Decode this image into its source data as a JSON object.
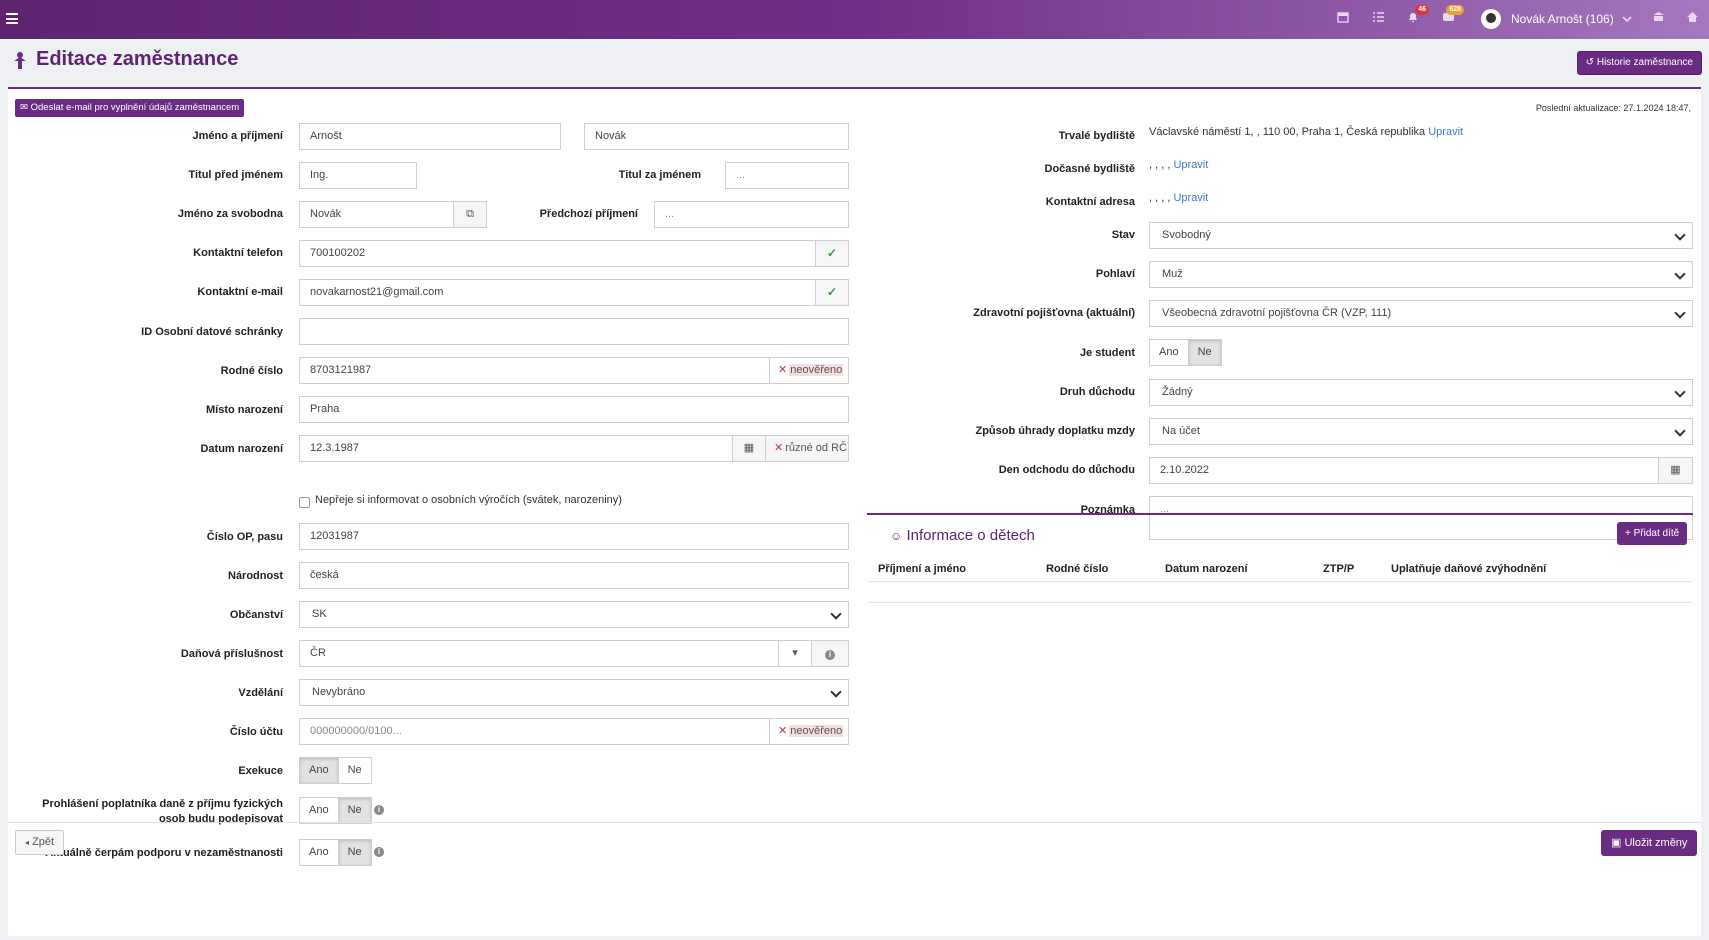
{
  "topbar": {
    "notifications_count": "46",
    "messages_count": "628",
    "user_name": "Novák Arnošt (106)"
  },
  "page": {
    "title": "Editace zaměstnance",
    "history_button": "Historie zaměstnance",
    "send_email_button": "Odeslat e-mail pro vyplnění údajů zaměstnancem",
    "last_update": "Poslední aktualizace: 27.1.2024 18:47,"
  },
  "left": {
    "name_label": "Jméno a příjmení",
    "first_name": "Arnošt",
    "last_name": "Novák",
    "title_before_label": "Titul před jménem",
    "title_before": "Ing.",
    "title_after_label": "Titul za jménem",
    "title_after_placeholder": "...",
    "maiden_label": "Jméno za svobodna",
    "maiden": "Novák",
    "prev_surname_label": "Předchozí příjmení",
    "prev_surname_placeholder": "...",
    "phone_label": "Kontaktní telefon",
    "phone": "700100202",
    "email_label": "Kontaktní e-mail",
    "email": "novakarnost21@gmail.com",
    "databox_label": "ID Osobní datové schránky",
    "databox": "",
    "birth_no_label": "Rodné číslo",
    "birth_no": "8703121987",
    "unverified": "neověřeno",
    "birth_place_label": "Místo narození",
    "birth_place": "Praha",
    "birth_date_label": "Datum narození",
    "birth_date": "12.3.1987",
    "differs_rc": "různé od RČ",
    "anniversary_checkbox": "Nepřeje si informovat o osobních výročích (svátek, narozeniny)",
    "id_card_label": "Číslo OP, pasu",
    "id_card": "12031987",
    "nationality_label": "Národnost",
    "nationality": "česká",
    "citizenship_label": "Občanství",
    "citizenship": "SK",
    "tax_residence_label": "Daňová příslušnost",
    "tax_residence": "ČR",
    "education_label": "Vzdělání",
    "education": "Nevybráno",
    "account_label": "Číslo účtu",
    "account_placeholder": "000000000/0100...",
    "execution_label": "Exekuce",
    "declaration_label": "Prohlášení poplatníka daně z příjmu fyzických osob budu podepisovat",
    "unemployment_label": "Aktuálně čerpám podporu v nezaměstnanosti",
    "yes": "Ano",
    "no": "Ne"
  },
  "right": {
    "perm_addr_label": "Trvalé bydliště",
    "perm_addr": "Václavské náměstí 1, , 110 00, Praha 1, Česká republika",
    "edit": "Upravit",
    "temp_addr_label": "Dočasné bydliště",
    "temp_addr": ", , , ,",
    "contact_addr_label": "Kontaktní adresa",
    "contact_addr": ", , , ,",
    "status_label": "Stav",
    "status": "Svobodný",
    "gender_label": "Pohlaví",
    "gender": "Muž",
    "insurance_label": "Zdravotní pojišťovna (aktuální)",
    "insurance": "Všeobecná zdravotní pojišťovna ČR (VZP, 111)",
    "student_label": "Je student",
    "pension_label": "Druh důchodu",
    "pension": "Žádný",
    "payment_label": "Způsob úhrady doplatku mzdy",
    "payment": "Na účet",
    "retire_date_label": "Den odchodu do důchodu",
    "retire_date": "2.10.2022",
    "note_label": "Poznámka",
    "note_placeholder": "..."
  },
  "kids": {
    "title": "Informace o dětech",
    "add_button": "Přidat dítě",
    "columns": [
      "Příjmení a jméno",
      "Rodné číslo",
      "Datum narození",
      "ZTP/P",
      "Uplatňuje daňové zvýhodnění"
    ]
  },
  "footer": {
    "back_button": "Zpět",
    "save_button": "Uložit změny"
  },
  "colors": {
    "brand": "#6a2c82",
    "badge_red": "#d9383a",
    "badge_orange": "#f0a030"
  }
}
